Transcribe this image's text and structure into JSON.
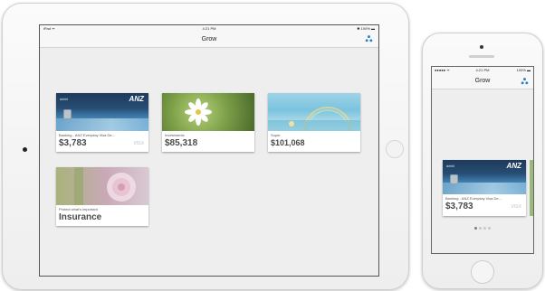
{
  "ipad": {
    "status": {
      "left": "iPad ᯤ",
      "time": "4:21 PM",
      "right": "✱ 100% ▬"
    },
    "nav_title": "Grow",
    "tiles": [
      {
        "kind": "card",
        "card_brand": "ANZ",
        "card_type": "debit",
        "caption": "Banking - ANZ Everyday Visa De...",
        "amount": "$3,783",
        "network": "VISA"
      },
      {
        "kind": "photo",
        "caption": "Investments",
        "amount": "$85,318"
      },
      {
        "kind": "photo",
        "caption": "Super",
        "amount": "$101,068"
      },
      {
        "kind": "photo",
        "caption": "Protect what's important",
        "amount": "Insurance"
      }
    ]
  },
  "iphone": {
    "status": {
      "left": "●●●●● ᯤ",
      "time": "4:21 PM",
      "right": "100% ▬"
    },
    "nav_title": "Grow",
    "tile": {
      "card_brand": "ANZ",
      "card_type": "debit",
      "caption": "Banking - ANZ Everyday Visa De...",
      "amount": "$3,783",
      "network": "VISA"
    },
    "page_dots": {
      "count": 4,
      "active": 1
    }
  },
  "icons": {
    "nav_right": "ANZ-share-icon"
  },
  "colors": {
    "card_navy": "#1d3a5c",
    "card_blue": "#3b77a6",
    "screen_bg": "#eeeeee"
  }
}
